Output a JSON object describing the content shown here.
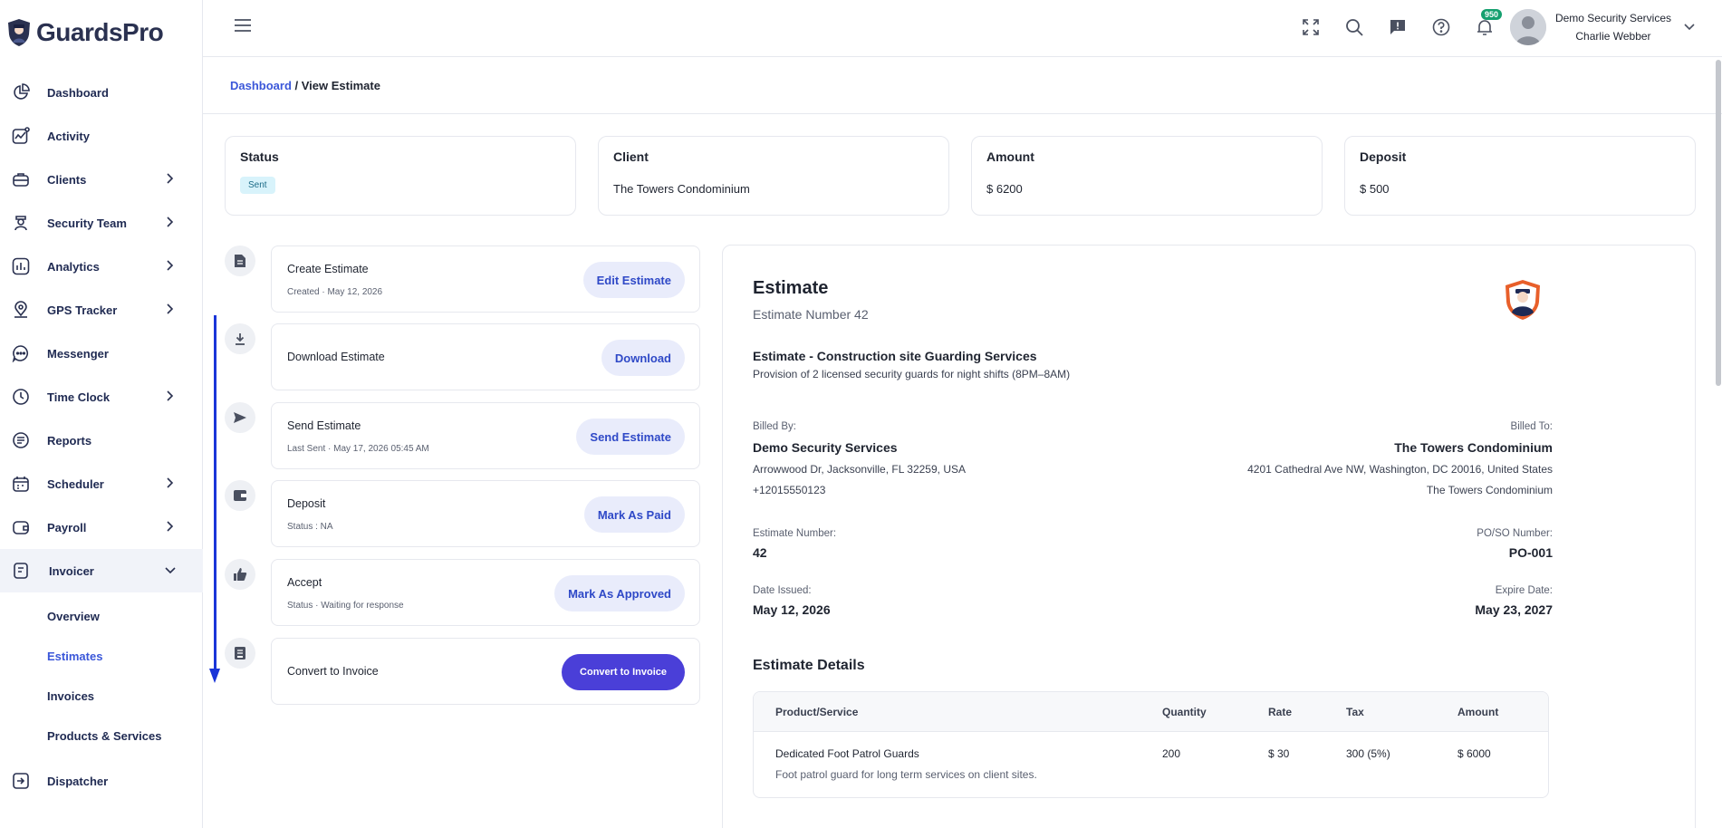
{
  "app": {
    "name": "GuardsPro"
  },
  "sidebar": {
    "items": [
      {
        "label": "Dashboard",
        "icon": "dashboard-icon"
      },
      {
        "label": "Activity",
        "icon": "activity-icon"
      },
      {
        "label": "Clients",
        "icon": "clients-icon"
      },
      {
        "label": "Security Team",
        "icon": "security-team-icon"
      },
      {
        "label": "Analytics",
        "icon": "analytics-icon"
      },
      {
        "label": "GPS Tracker",
        "icon": "gps-icon"
      },
      {
        "label": "Messenger",
        "icon": "messenger-icon"
      },
      {
        "label": "Time Clock",
        "icon": "clock-icon"
      },
      {
        "label": "Reports",
        "icon": "reports-icon"
      },
      {
        "label": "Scheduler",
        "icon": "calendar-icon"
      },
      {
        "label": "Payroll",
        "icon": "wallet-icon"
      },
      {
        "label": "Invoicer",
        "icon": "invoice-icon"
      }
    ],
    "invoicer_sub": [
      "Overview",
      "Estimates",
      "Invoices",
      "Products & Services"
    ],
    "dispatcher": "Dispatcher"
  },
  "topbar": {
    "notification_count": "950",
    "company": "Demo Security Services",
    "user": "Charlie Webber"
  },
  "breadcrumb": {
    "root": "Dashboard",
    "separator": " / ",
    "current": "View Estimate"
  },
  "summary": {
    "status_title": "Status",
    "status_value": "Sent",
    "client_title": "Client",
    "client_value": "The Towers Condominium",
    "amount_title": "Amount",
    "amount_value": "$ 6200",
    "deposit_title": "Deposit",
    "deposit_value": "$ 500"
  },
  "steps": [
    {
      "title": "Create Estimate",
      "sub": "Created · May 12, 2026",
      "button": "Edit Estimate"
    },
    {
      "title": "Download Estimate",
      "sub": "",
      "button": "Download"
    },
    {
      "title": "Send Estimate",
      "sub": "Last Sent · May 17, 2026 05:45 AM",
      "button": "Send Estimate"
    },
    {
      "title": "Deposit",
      "sub": "Status : NA",
      "button": "Mark As Paid"
    },
    {
      "title": "Accept",
      "sub": "Status · Waiting for response",
      "button": "Mark As Approved"
    },
    {
      "title": "Convert to Invoice",
      "sub": "",
      "button": "Convert to Invoice"
    }
  ],
  "estimate": {
    "heading": "Estimate",
    "number_line": "Estimate Number 42",
    "title": "Estimate - Construction site Guarding Services",
    "description": "Provision of 2 licensed security guards for night shifts (8PM–8AM)",
    "billed_by_label": "Billed By:",
    "billed_by_name": "Demo Security Services",
    "billed_by_address": "Arrowwood Dr, Jacksonville, FL 32259, USA",
    "billed_by_phone": "+12015550123",
    "billed_to_label": "Billed To:",
    "billed_to_name": "The Towers Condominium",
    "billed_to_address": "4201 Cathedral Ave NW, Washington, DC 20016, United States",
    "billed_to_extra": "The Towers Condominium",
    "est_number_label": "Estimate Number:",
    "est_number": "42",
    "po_label": "PO/SO Number:",
    "po": "PO-001",
    "issued_label": "Date Issued:",
    "issued": "May 12, 2026",
    "expire_label": "Expire Date:",
    "expire": "May 23, 2027",
    "details_heading": "Estimate Details",
    "table": {
      "headers": [
        "Product/Service",
        "Quantity",
        "Rate",
        "Tax",
        "Amount"
      ],
      "rows": [
        {
          "product": "Dedicated Foot Patrol Guards",
          "note": "Foot patrol guard for long term services on client sites.",
          "quantity": "200",
          "rate": "$ 30",
          "tax": "300 (5%)",
          "amount": "$ 6000"
        }
      ]
    }
  },
  "colors": {
    "accent": "#3b57d9",
    "primary_button": "#4a3fd8",
    "timeline_arrow": "#1a35d8",
    "badge": "#15a06f"
  }
}
